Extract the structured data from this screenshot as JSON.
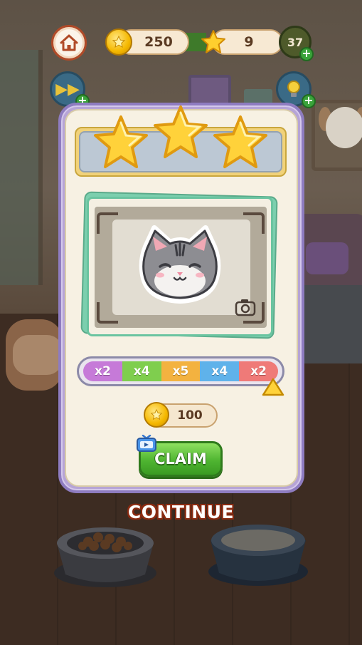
{
  "hud": {
    "coins": "250",
    "stars": "9",
    "level": "37",
    "home_icon": "home-icon",
    "coin_icon": "coin-icon",
    "star_icon": "star-icon",
    "skip_icon": "fast-forward-icon",
    "hint_icon": "lightbulb-icon"
  },
  "result": {
    "stars_earned": 3,
    "stars_total": 3,
    "photo_subject": "cat-face",
    "camera_icon": "camera-icon"
  },
  "multiplier": {
    "segments": [
      {
        "label": "x2",
        "color": "#c67ad8"
      },
      {
        "label": "x4",
        "color": "#7fce4e"
      },
      {
        "label": "x5",
        "color": "#f3b240"
      },
      {
        "label": "x4",
        "color": "#5fb2ea"
      },
      {
        "label": "x2",
        "color": "#ef7a78"
      }
    ],
    "pointer_index": 4
  },
  "reward": {
    "amount": "100"
  },
  "buttons": {
    "claim_label": "CLAIM",
    "claim_ad_icon": "video-ad-icon",
    "continue_label": "CONTINUE"
  }
}
